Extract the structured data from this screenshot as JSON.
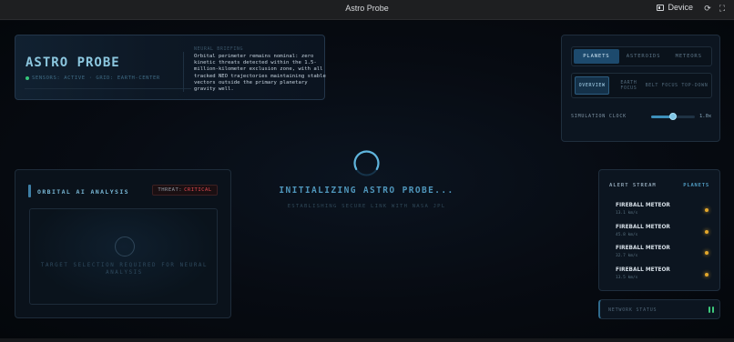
{
  "window": {
    "title": "Astro Probe",
    "device_label": "Device"
  },
  "brand": {
    "logo": "ASTRO PROBE",
    "sensors": "SENSORS: ACTIVE · GRID: EARTH-CENTER",
    "briefing_label": "NEURAL BRIEFING",
    "briefing_text": "Orbital perimeter remains nominal: zero kinetic threats detected within the 1.5-million-kilometer exclusion zone, with all tracked NEO trajectories maintaining stable vectors outside the primary planetary gravity well."
  },
  "controls": {
    "tabs": [
      {
        "label": "PLANETS",
        "active": true
      },
      {
        "label": "ASTEROIDS",
        "active": false
      },
      {
        "label": "METEORS",
        "active": false
      }
    ],
    "views": [
      {
        "label": "OVERVIEW",
        "active": true
      },
      {
        "label": "EARTH FOCUS",
        "active": false
      },
      {
        "label": "BELT FOCUS",
        "active": false
      },
      {
        "label": "TOP-DOWN",
        "active": false
      }
    ],
    "clock_label": "SIMULATION CLOCK",
    "clock_value": "1.0x",
    "clock_fraction": 0.5
  },
  "loader": {
    "title": "INITIALIZING ASTRO PROBE...",
    "subtitle": "ESTABLISHING SECURE LINK WITH NASA JPL"
  },
  "ai_panel": {
    "title": "ORBITAL AI ANALYSIS",
    "threat_label": "THREAT:",
    "threat_value": "CRITICAL",
    "target_text": "TARGET SELECTION REQUIRED FOR NEURAL ANALYSIS"
  },
  "alerts": {
    "title": "ALERT STREAM",
    "filter": "PLANETS",
    "items": [
      {
        "name": "FIREBALL METEOR",
        "speed": "13.1 km/s"
      },
      {
        "name": "FIREBALL METEOR",
        "speed": "45.8 km/s"
      },
      {
        "name": "FIREBALL METEOR",
        "speed": "32.7 km/s"
      },
      {
        "name": "FIREBALL METEOR",
        "speed": "13.5 km/s"
      }
    ]
  },
  "network": {
    "label": "NETWORK STATUS"
  },
  "colors": {
    "accent": "#4f96bb",
    "critical": "#e0484f",
    "alert_dot": "#e3a72b",
    "status_ok": "#3ec97c"
  }
}
